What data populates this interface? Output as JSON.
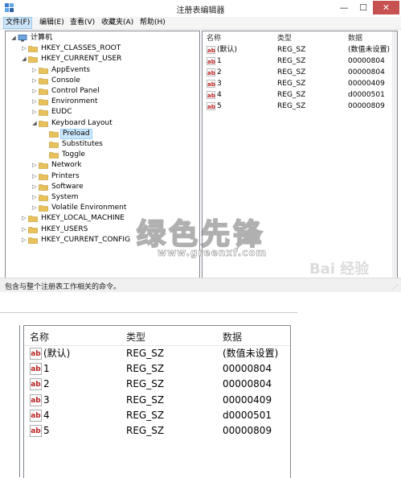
{
  "window": {
    "title": "注册表编辑器",
    "buttons": {
      "minimize": "—",
      "maximize": "☐",
      "close": "✕"
    }
  },
  "menu": [
    "文件(F)",
    "编辑(E)",
    "查看(V)",
    "收藏夹(A)",
    "帮助(H)"
  ],
  "tree": {
    "items": [
      {
        "label": "计算机",
        "expander": "◢"
      },
      {
        "label": "HKEY_CLASSES_ROOT",
        "expander": "▷"
      },
      {
        "label": "HKEY_CURRENT_USER",
        "expander": "◢"
      },
      {
        "label": "AppEvents",
        "expander": "▷"
      },
      {
        "label": "Console",
        "expander": "▷"
      },
      {
        "label": "Control Panel",
        "expander": "▷"
      },
      {
        "label": "Environment",
        "expander": "▷"
      },
      {
        "label": "EUDC",
        "expander": "▷"
      },
      {
        "label": "Keyboard Layout",
        "expander": "◢"
      },
      {
        "label": "Preload",
        "expander": ""
      },
      {
        "label": "Substitutes",
        "expander": ""
      },
      {
        "label": "Toggle",
        "expander": ""
      },
      {
        "label": "Network",
        "expander": "▷"
      },
      {
        "label": "Printers",
        "expander": "▷"
      },
      {
        "label": "Software",
        "expander": "▷"
      },
      {
        "label": "System",
        "expander": "▷"
      },
      {
        "label": "Volatile Environment",
        "expander": "▷"
      },
      {
        "label": "HKEY_LOCAL_MACHINE",
        "expander": "▷"
      },
      {
        "label": "HKEY_USERS",
        "expander": "▷"
      },
      {
        "label": "HKEY_CURRENT_CONFIG",
        "expander": "▷"
      }
    ]
  },
  "list": {
    "headers": {
      "name": "名称",
      "type": "类型",
      "data": "数据"
    },
    "icon_text": "ab",
    "rows": [
      {
        "name": "(默认)",
        "type": "REG_SZ",
        "data": "(数值未设置)"
      },
      {
        "name": "1",
        "type": "REG_SZ",
        "data": "00000804"
      },
      {
        "name": "2",
        "type": "REG_SZ",
        "data": "00000804"
      },
      {
        "name": "3",
        "type": "REG_SZ",
        "data": "00000409"
      },
      {
        "name": "4",
        "type": "REG_SZ",
        "data": "d0000501"
      },
      {
        "name": "5",
        "type": "REG_SZ",
        "data": "00000809"
      }
    ]
  },
  "status": "包含与整个注册表工作相关的命令。",
  "watermark": {
    "title": "绿色先锋",
    "url": "www.greenxf.com",
    "brand": "Bai 经验"
  },
  "colors": {
    "selection": "#cce8ff",
    "close_button": "#c75050",
    "folder": "#e8c15a"
  }
}
